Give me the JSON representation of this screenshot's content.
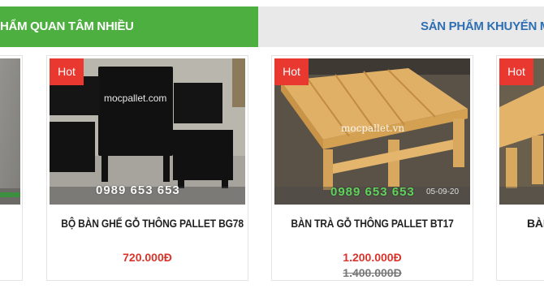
{
  "tabs": [
    {
      "label": "SẢN PHẨM QUAN TÂM NHIỀU",
      "visible_label": "HẨM QUAN TÂM NHIỀU",
      "active": true
    },
    {
      "label": "SẢN PHẨM KHUYẾN MẠI",
      "active": false
    }
  ],
  "colors": {
    "accent_green": "#4caf3f",
    "tab_inactive_bg": "#e9e9e9",
    "tab_inactive_text": "#2e6fb3",
    "price_red": "#d9342b",
    "hot_badge": "#e8382f"
  },
  "products": [
    {
      "badge": "",
      "name": "",
      "price": "",
      "old_price": ""
    },
    {
      "badge": "Hot",
      "watermark": "mocpallet.com",
      "phone": "0989 653 653",
      "name": "BỘ BÀN GHẾ GỖ THÔNG PALLET BG78",
      "price": "720.000Đ",
      "old_price": ""
    },
    {
      "badge": "Hot",
      "watermark": "mocpallet.vn",
      "phone": "0989 653 653",
      "photo_date": "05-09-20",
      "name": "BÀN TRÀ GỖ THÔNG PALLET BT17",
      "price": "1.200.000Đ",
      "old_price": "1.400.000Đ"
    },
    {
      "badge": "Hot",
      "name": "BÀN",
      "price": "",
      "old_price": ""
    }
  ]
}
